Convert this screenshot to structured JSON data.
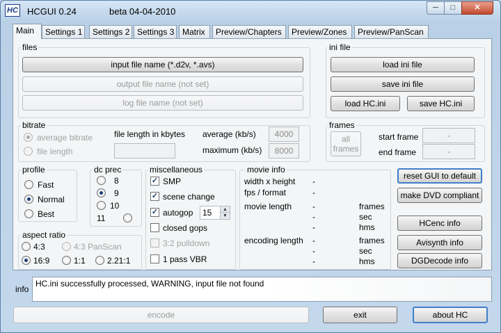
{
  "window": {
    "app_icon_text": "HC",
    "title": "HCGUI 0.24",
    "beta_label": "beta  04-04-2010",
    "min_glyph": "─",
    "max_glyph": "□",
    "close_glyph": "✕"
  },
  "tabs": [
    "Main",
    "Settings 1",
    "Settings 2",
    "Settings 3",
    "Matrix",
    "Preview/Chapters",
    "Preview/Zones",
    "Preview/PanScan"
  ],
  "files": {
    "label": "files",
    "input_button": "input file name (*.d2v, *.avs)",
    "output_button": "output file name (not set)",
    "log_button": "log file name (not set)"
  },
  "ini": {
    "label": "ini file",
    "load_ini": "load ini file",
    "save_ini": "save ini file",
    "load_hc": "load HC.ini",
    "save_hc": "save HC.ini"
  },
  "bitrate": {
    "label": "bitrate",
    "average_bitrate": "average bitrate",
    "file_length": "file length",
    "file_length_kbytes": "file length in kbytes",
    "average_label": "average (kb/s)",
    "average_value": "4000",
    "maximum_label": "maximum (kb/s)",
    "maximum_value": "8000"
  },
  "frames": {
    "label": "frames",
    "all_frames": "all frames",
    "start_frame": "start frame",
    "end_frame": "end frame",
    "start_value": "-",
    "end_value": "-"
  },
  "profile": {
    "label": "profile",
    "options": [
      "Fast",
      "Normal",
      "Best"
    ],
    "selected": "Normal"
  },
  "dc_prec": {
    "label": "dc prec",
    "options": [
      "8",
      "9",
      "10",
      "11"
    ],
    "selected": "9"
  },
  "misc": {
    "label": "miscellaneous",
    "smp": "SMP",
    "scene_change": "scene change",
    "autogop": "autogop",
    "autogop_value": "15",
    "closed_gops": "closed gops",
    "pulldown": "3:2 pulldown",
    "one_pass_vbr": "1 pass VBR",
    "check_glyph": "✓"
  },
  "movie_info": {
    "label": "movie info",
    "width_height": "width x height",
    "fps_format": "fps / format",
    "movie_length": "movie length",
    "encoding_length": "encoding length",
    "dash": "-",
    "frames_unit": "frames",
    "sec_unit": "sec",
    "hms_unit": "hms"
  },
  "aspect": {
    "label": "aspect ratio",
    "a43": "4:3",
    "a43pan": "4:3 PanScan",
    "a169": "16:9",
    "a11": "1:1",
    "a221": "2.21:1",
    "selected": "16:9"
  },
  "right_buttons": {
    "reset_gui": "reset GUI to default",
    "dvd_compliant": "make DVD compliant",
    "hcenc_info": "HCenc info",
    "avisynth_info": "Avisynth info",
    "dgdecode_info": "DGDecode info"
  },
  "status": {
    "info_label": "info",
    "message": "HC.ini successfully processed, WARNING, input file not found"
  },
  "bottom": {
    "encode": "encode",
    "exit": "exit",
    "about": "about HC"
  }
}
